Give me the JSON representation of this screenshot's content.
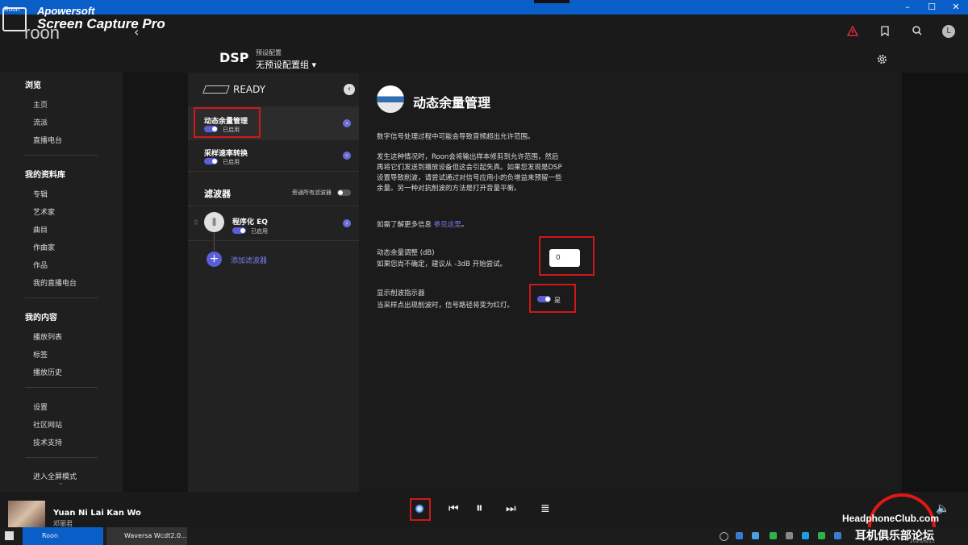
{
  "window": {
    "title_overlay_app": "Roon",
    "watermark_line1": "Apowersoft",
    "watermark_line2": "Screen Capture Pro",
    "app_logo": "roon",
    "controls": [
      "–",
      "☐",
      "✕"
    ]
  },
  "header": {
    "back_icon": "‹",
    "page": "DSP",
    "preset_label": "预设配置",
    "preset_value": "无预设配置组",
    "icons": [
      "warning-icon",
      "bookmark-icon",
      "search-icon"
    ],
    "avatar_letter": "L",
    "warning_color": "#e02a3a",
    "accent": "#5b5fd6"
  },
  "nav": {
    "browse_head": "浏览",
    "browse": [
      "主页",
      "流派",
      "直播电台"
    ],
    "library_head": "我的资料库",
    "library": [
      "专辑",
      "艺术家",
      "曲目",
      "作曲家",
      "作品",
      "我的直播电台"
    ],
    "mine_head": "我的内容",
    "mine": [
      "播放列表",
      "标签",
      "播放历史"
    ],
    "misc": [
      "设置",
      "社区网站",
      "技术支持"
    ],
    "fullscreen": "进入全屏模式"
  },
  "dsp": {
    "zone": "READY",
    "items": [
      {
        "title": "动态余量管理",
        "status": "已启用"
      },
      {
        "title": "采样速率转换",
        "status": "已启用"
      }
    ],
    "filters_head": "滤波器",
    "bypass_label": "旁通所有滤波器",
    "eq": {
      "title": "程序化 EQ",
      "status": "已启用"
    },
    "add_filter": "添加滤波器"
  },
  "detail": {
    "title": "动态余量管理",
    "p1": "数字信号处理过程中可能会导致音频超出允许范围。",
    "p2": "发生这种情况时，Roon会将输出样本修剪到允许范围，然后再将它们发送到播放设备但这会引起失真。如果您发现是DSP设置导致削波，请尝试通过对信号应用小的负增益来预留一些余量。另一种对抗削波的方法是打开音量平衡。",
    "more_prefix": "如需了解更多信息",
    "more_link": "参见这里",
    "more_suffix": "。",
    "headroom_label": "动态余量调整 (dB)",
    "headroom_hint": "如果您尚不确定，建议从 -3dB 开始尝试。",
    "headroom_value": "0",
    "clip_label": "显示削波指示器",
    "clip_hint": "当采样点出现削波时，信号路径将变为红灯。",
    "clip_value": "是"
  },
  "player": {
    "song": "Yuan Ni Lai Kan Wo",
    "artist": "邓丽君",
    "controls": [
      "⏮",
      "⏸",
      "⏭"
    ],
    "queue_icon": "≣",
    "volume_icon": "🔈"
  },
  "taskbar": {
    "roon": "Roon",
    "waversa": "Waversa Wcdt2.0...",
    "clock": "2023/6/13"
  },
  "forum": {
    "site": "HeadphoneClub.com",
    "name": "耳机俱乐部论坛"
  }
}
